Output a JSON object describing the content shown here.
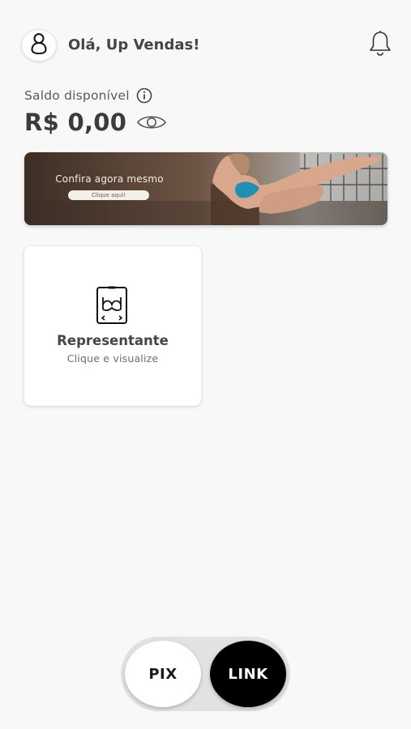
{
  "header": {
    "greeting": "Olá, Up Vendas!",
    "avatar_icon": "user-icon",
    "notification_icon": "bell-icon"
  },
  "balance": {
    "label": "Saldo disponível",
    "info_icon": "info-icon",
    "value": "R$ 0,00",
    "visibility_icon": "eye-icon"
  },
  "banner": {
    "title": "Confira agora mesmo",
    "cta": "Clique aqui!"
  },
  "cards": [
    {
      "title": "Representante",
      "subtitle": "Clique e visualize",
      "icon": "lingerie-catalog-icon"
    }
  ],
  "payment_toggle": {
    "options": [
      "PIX",
      "LINK"
    ],
    "selected": "LINK"
  },
  "colors": {
    "background": "#f8f8f8",
    "text": "#3a3a3a",
    "toggle_active": "#000000",
    "toggle_inactive": "#ffffff",
    "toggle_track": "#e2e2e2"
  }
}
